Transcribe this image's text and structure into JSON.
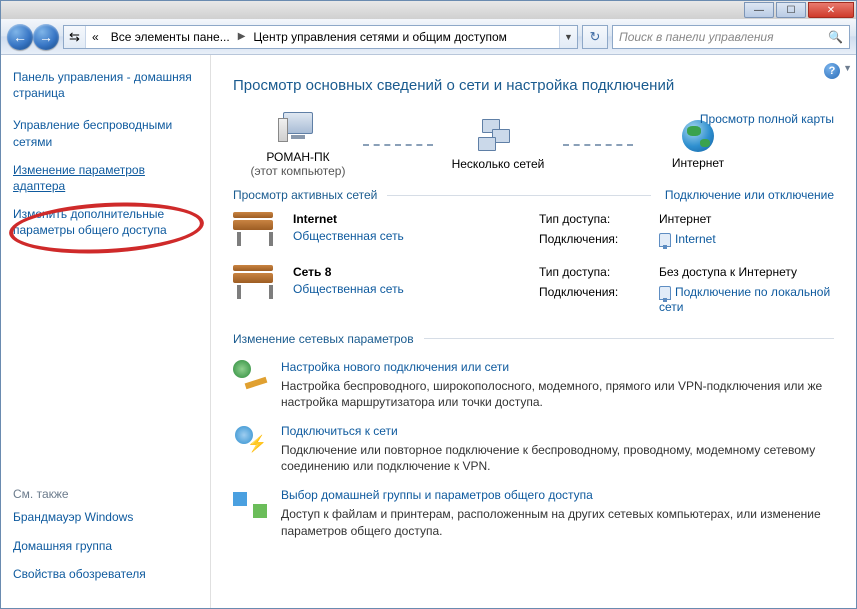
{
  "titlebar": {
    "min": "—",
    "max": "☐",
    "close": "✕"
  },
  "nav": {
    "breadcrumb_icon": "«",
    "crumb1": "Все элементы пане...",
    "crumb2": "Центр управления сетями и общим доступом",
    "search_placeholder": "Поиск в панели управления"
  },
  "sidebar": {
    "home": "Панель управления - домашняя страница",
    "link_wireless": "Управление беспроводными сетями",
    "link_adapter": "Изменение параметров адаптера",
    "link_sharing": "Изменить дополнительные параметры общего доступа",
    "see_also": "См. также",
    "link_fw": "Брандмауэр Windows",
    "link_hg": "Домашняя группа",
    "link_inet": "Свойства обозревателя"
  },
  "main": {
    "title": "Просмотр основных сведений о сети и настройка подключений",
    "map_link": "Просмотр полной карты",
    "pc_name": "РОМАН-ПК",
    "pc_sub": "(этот компьютер)",
    "multi": "Несколько сетей",
    "internet": "Интернет",
    "active_head": "Просмотр активных сетей",
    "connect_link": "Подключение или отключение",
    "net1": {
      "name": "Internet",
      "type": "Общественная сеть",
      "access_lbl": "Тип доступа:",
      "access_val": "Интернет",
      "conn_lbl": "Подключения:",
      "conn_val": "Internet"
    },
    "net2": {
      "name": "Сеть  8",
      "type": "Общественная сеть",
      "access_lbl": "Тип доступа:",
      "access_val": "Без доступа к Интернету",
      "conn_lbl": "Подключения:",
      "conn_val": "Подключение по локальной сети"
    },
    "settings_head": "Изменение сетевых параметров",
    "s1_title": "Настройка нового подключения или сети",
    "s1_desc": "Настройка беспроводного, широкополосного, модемного, прямого или VPN-подключения или же настройка маршрутизатора или точки доступа.",
    "s2_title": "Подключиться к сети",
    "s2_desc": "Подключение или повторное подключение к беспроводному, проводному, модемному сетевому соединению или подключение к VPN.",
    "s3_title": "Выбор домашней группы и параметров общего доступа",
    "s3_desc": "Доступ к файлам и принтерам, расположенным на других сетевых компьютерах, или изменение параметров общего доступа."
  }
}
